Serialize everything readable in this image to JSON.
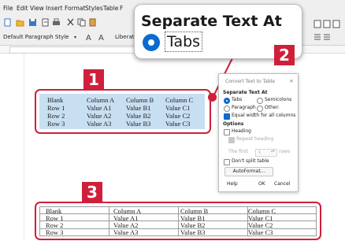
{
  "menubar": {
    "items": [
      "File",
      "Edit",
      "View",
      "Insert",
      "Format",
      "Styles",
      "Table",
      "F"
    ]
  },
  "toolbar": {
    "paragraph_style": "Default Paragraph Style",
    "font_name": "Liberation Se",
    "icons": [
      "new-icon",
      "open-icon",
      "save-icon",
      "export-icon",
      "print-icon",
      "cut-icon",
      "copy-icon",
      "paste-icon"
    ]
  },
  "zoom_popup": {
    "title": "Separate Text At",
    "option_label": "Tabs"
  },
  "callouts": {
    "badge_1": "1",
    "badge_2": "2",
    "badge_3": "3"
  },
  "table_before": {
    "rows": [
      [
        "Blank",
        "Column A",
        "Column B",
        "Column C"
      ],
      [
        "Row 1",
        "Value A1",
        "Value B1",
        "Value C1"
      ],
      [
        "Row 2",
        "Value A2",
        "Value B2",
        "Value C2"
      ],
      [
        "Row 3",
        "Value A3",
        "Value B3",
        "Value C3"
      ]
    ]
  },
  "table_after": {
    "rows": [
      [
        "Blank",
        "Column A",
        "Column B",
        "Column C"
      ],
      [
        "Row 1",
        "Value A1",
        "Value B1",
        "Value C1"
      ],
      [
        "Row 2",
        "Value A2",
        "Value B2",
        "Value C2"
      ],
      [
        "Row 3",
        "Value A3",
        "Value B3",
        "Value C3"
      ]
    ]
  },
  "dialog": {
    "title": "Convert Text to Table",
    "close": "×",
    "separate_heading": "Separate Text At",
    "opt_tabs": "Tabs",
    "opt_semicolons": "Semicolons",
    "opt_paragraph": "Paragraph",
    "opt_other": "Other:",
    "equal_width": "Equal width for all columns",
    "options_heading": "Options",
    "heading": "Heading",
    "repeat_heading": "Repeat heading",
    "the_first": "The first",
    "first_value": "1",
    "rows": "rows",
    "dont_split": "Don't split table",
    "autoformat": "AutoFormat...",
    "help": "Help",
    "ok": "OK",
    "cancel": "Cancel"
  },
  "colors": {
    "accent_red": "#cf1f3a",
    "radio_blue": "#0b6bd0",
    "selection_blue": "#c8dff2"
  }
}
